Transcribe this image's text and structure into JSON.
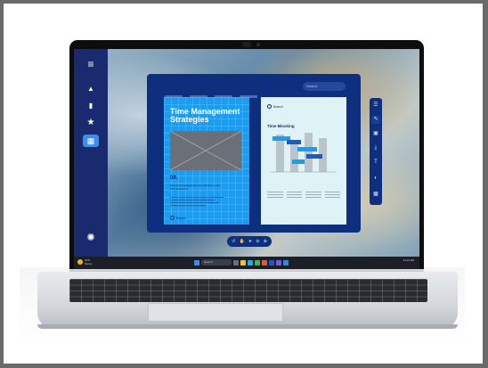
{
  "app": {
    "search_placeholder": "Search",
    "sidebar": [
      {
        "icon": "menu-icon",
        "glyph": "≡"
      },
      {
        "icon": "triangle-icon",
        "glyph": "▲"
      },
      {
        "icon": "bar-chart-icon",
        "glyph": "▮"
      },
      {
        "icon": "star-icon",
        "glyph": "★"
      },
      {
        "icon": "layout-icon",
        "glyph": "▦"
      },
      {
        "icon": "settings-icon",
        "glyph": "✺"
      }
    ],
    "doc_left": {
      "title": "Time Management Strategies",
      "number": "09.",
      "subtitle": "How time management can achieve more and stress less",
      "logo": "Brand"
    },
    "doc_right": {
      "logo": "Brand",
      "title": "Time Blocking"
    },
    "toolbar": [
      "list-icon",
      "pen-icon",
      "image-icon",
      "download-icon",
      "text-icon",
      "contrast-icon",
      "qr-icon"
    ],
    "bottom_tools": [
      "undo-icon",
      "hand-icon",
      "pointer-icon",
      "zoom-out-icon",
      "zoom-in-icon"
    ]
  },
  "taskbar": {
    "weather_temp": "24°F",
    "weather_desc": "Sunny",
    "search": "Search",
    "time": "11:11 AM",
    "date": "11/12/2024"
  },
  "colors": {
    "sidebar": "#1a2a6e",
    "app_bg": "#0e2f7e",
    "accent": "#1a9cf0",
    "doc_right_bg": "#dff2f6"
  }
}
